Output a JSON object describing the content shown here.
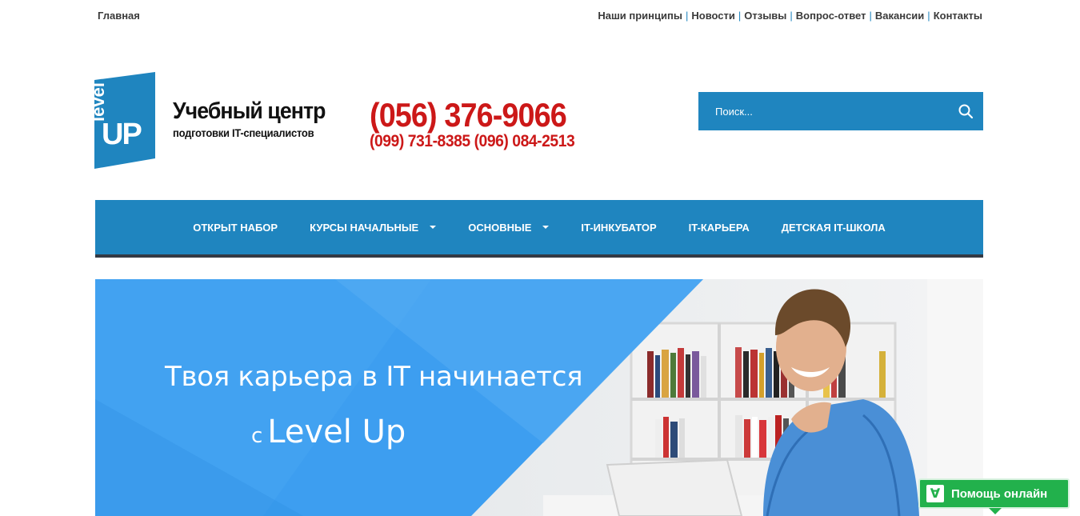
{
  "topbar": {
    "home_label": "Главная",
    "links": [
      "Наши принципы",
      "Новости",
      "Отзывы",
      "Вопрос-ответ",
      "Вакансии",
      "Контакты"
    ],
    "separator": "|"
  },
  "logo": {
    "word_top": "level",
    "word_bottom": "UP"
  },
  "brand": {
    "title": "Учебный центр",
    "subtitle": "подготовки IT-специалистов"
  },
  "phones": {
    "main": "(056) 376-9066",
    "alt": "(099) 731-8385 (096) 084-2513"
  },
  "search": {
    "placeholder": "Поиск..."
  },
  "nav": {
    "items": [
      {
        "label": "ОТКРЫТ НАБОР"
      },
      {
        "label": "КУРСЫ НАЧАЛЬНЫЕ"
      },
      {
        "label": "ОСНОВНЫЕ"
      },
      {
        "label": "IT-ИНКУБАТОР"
      },
      {
        "label": "IT-КАРЬЕРА"
      },
      {
        "label": "ДЕТСКАЯ IT-ШКОЛА"
      }
    ]
  },
  "hero": {
    "line1": "Твоя карьера в IT начинается",
    "line2_prefix": "с",
    "line2_main": "Level Up"
  },
  "help": {
    "label": "Помощь онлайн",
    "icon_glyph": "∀"
  },
  "colors": {
    "brand_blue": "#1f85bf",
    "phone_red": "#cc1818",
    "help_green": "#22b14c",
    "nav_border": "#333a44"
  }
}
